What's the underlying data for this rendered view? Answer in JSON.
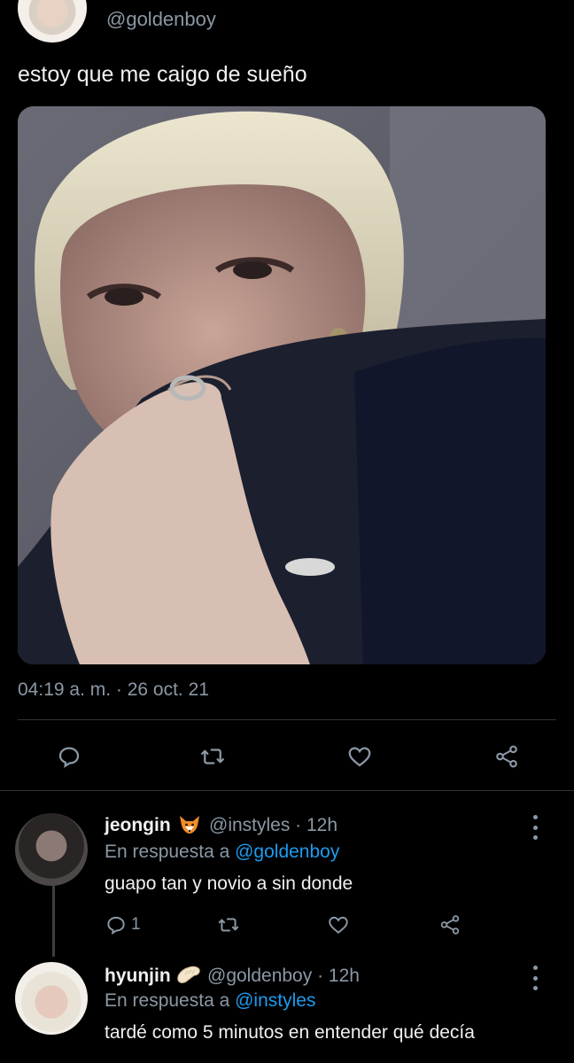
{
  "tweet": {
    "handle": "@goldenboy",
    "text": "estoy que me caigo de sueño",
    "timestamp": "04:19 a. m. · 26 oct. 21"
  },
  "actions": {
    "icons": [
      "reply-icon",
      "retweet-icon",
      "like-icon",
      "share-icon"
    ]
  },
  "replies": [
    {
      "name": "jeongin",
      "emoji_icon": "fox-icon",
      "handle_time": "@instyles · 12h",
      "reply_prefix": "En respuesta a",
      "reply_to": "@goldenboy",
      "text": "guapo tan y novio a sin donde",
      "reply_count": "1"
    },
    {
      "name": "hyunjin",
      "emoji_icon": "bread-icon",
      "handle_time": "@goldenboy · 12h",
      "reply_prefix": "En respuesta a",
      "reply_to": "@instyles",
      "text": "tardé como 5 minutos en entender qué decía"
    }
  ],
  "colors": {
    "background": "#000000",
    "muted": "#8b98a5",
    "link": "#1d9bf0",
    "divider": "#2f3336"
  }
}
